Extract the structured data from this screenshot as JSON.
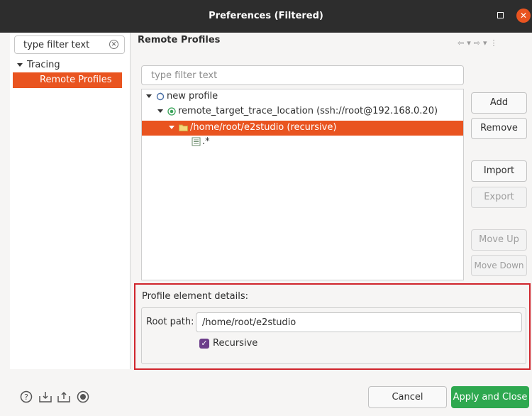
{
  "window": {
    "title": "Preferences (Filtered)"
  },
  "left": {
    "search_value": "type filter text",
    "tree": [
      {
        "label": "Tracing",
        "expanded": true
      },
      {
        "label": "Remote Profiles",
        "selected": true
      }
    ]
  },
  "right": {
    "header": "Remote Profiles",
    "filter_placeholder": "type filter text",
    "tree": {
      "profile": "new profile",
      "location": "remote_target_trace_location (ssh://root@192.168.0.20)",
      "path": "/home/root/e2studio (recursive)",
      "file": ".*"
    },
    "buttons": {
      "add": "Add",
      "remove": "Remove",
      "import": "Import",
      "export": "Export",
      "move_up": "Move Up",
      "move_down": "Move Down"
    },
    "details": {
      "label": "Profile element details:",
      "root_path_label": "Root path:",
      "root_path_value": "/home/root/e2studio",
      "recursive_label": "Recursive",
      "recursive_checked": true
    }
  },
  "footer": {
    "cancel": "Cancel",
    "apply": "Apply and Close"
  },
  "colors": {
    "accent": "#e95420",
    "apply": "#2ea84f",
    "highlight_border": "#d0252c",
    "checkbox": "#6c3d8a"
  }
}
